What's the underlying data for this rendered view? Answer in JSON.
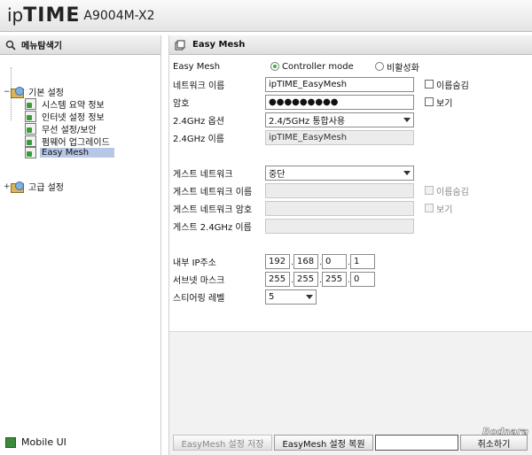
{
  "header": {
    "brand_ip": "ip",
    "brand_time": "TIME",
    "model": "A9004M-X2"
  },
  "sidebar": {
    "title": "메뉴탐색기",
    "tree": [
      {
        "label": "기본 설정",
        "icon": "folder-icon",
        "expander": "−",
        "children": [
          {
            "label": "시스템 요약 정보"
          },
          {
            "label": "인터넷 설정 정보"
          },
          {
            "label": "무선 설정/보안"
          },
          {
            "label": "펌웨어 업그레이드"
          },
          {
            "label": "Easy Mesh",
            "selected": true
          }
        ]
      },
      {
        "label": "고급 설정",
        "icon": "folder-icon",
        "expander": "+"
      }
    ],
    "mobile_label": "Mobile UI"
  },
  "main": {
    "title": "Easy Mesh",
    "easymesh": {
      "label": "Easy Mesh",
      "option_controller": "Controller mode",
      "option_disabled": "비활성화",
      "selected": "Controller mode"
    },
    "network_name": {
      "label": "네트워크 이름",
      "value": "ipTIME_EasyMesh",
      "hide_label": "이름숨김"
    },
    "password": {
      "label": "암호",
      "value": "●●●●●●●●●",
      "show_label": "보기"
    },
    "band_option": {
      "label": "2.4GHz 옵션",
      "value": "2.4/5GHz 통합사용"
    },
    "band_name": {
      "label": "2.4GHz 이름",
      "value": "ipTIME_EasyMesh"
    },
    "guest": {
      "label": "게스트 네트워크",
      "value": "중단"
    },
    "guest_name": {
      "label": "게스트 네트워크 이름",
      "hide_label": "이름숨김"
    },
    "guest_password": {
      "label": "게스트 네트워크 암호",
      "show_label": "보기"
    },
    "guest_24_name": {
      "label": "게스트 2.4GHz 이름"
    },
    "internal_ip": {
      "label": "내부 IP주소",
      "octets": [
        "192",
        "168",
        "0",
        "1"
      ]
    },
    "subnet": {
      "label": "서브넷 마스크",
      "octets": [
        "255",
        "255",
        "255",
        "0"
      ]
    },
    "steering": {
      "label": "스티어링 레벨",
      "value": "5"
    },
    "buttons": {
      "save": "EasyMesh 설정 저장",
      "restore": "EasyMesh 설정 복원",
      "restore_hint": "취소하기"
    },
    "watermark": "Bodnara"
  },
  "colors": {
    "selected_bg": "#b7c7e6",
    "radio_on": "#2eb82e",
    "disabled_bg": "#ececec"
  }
}
